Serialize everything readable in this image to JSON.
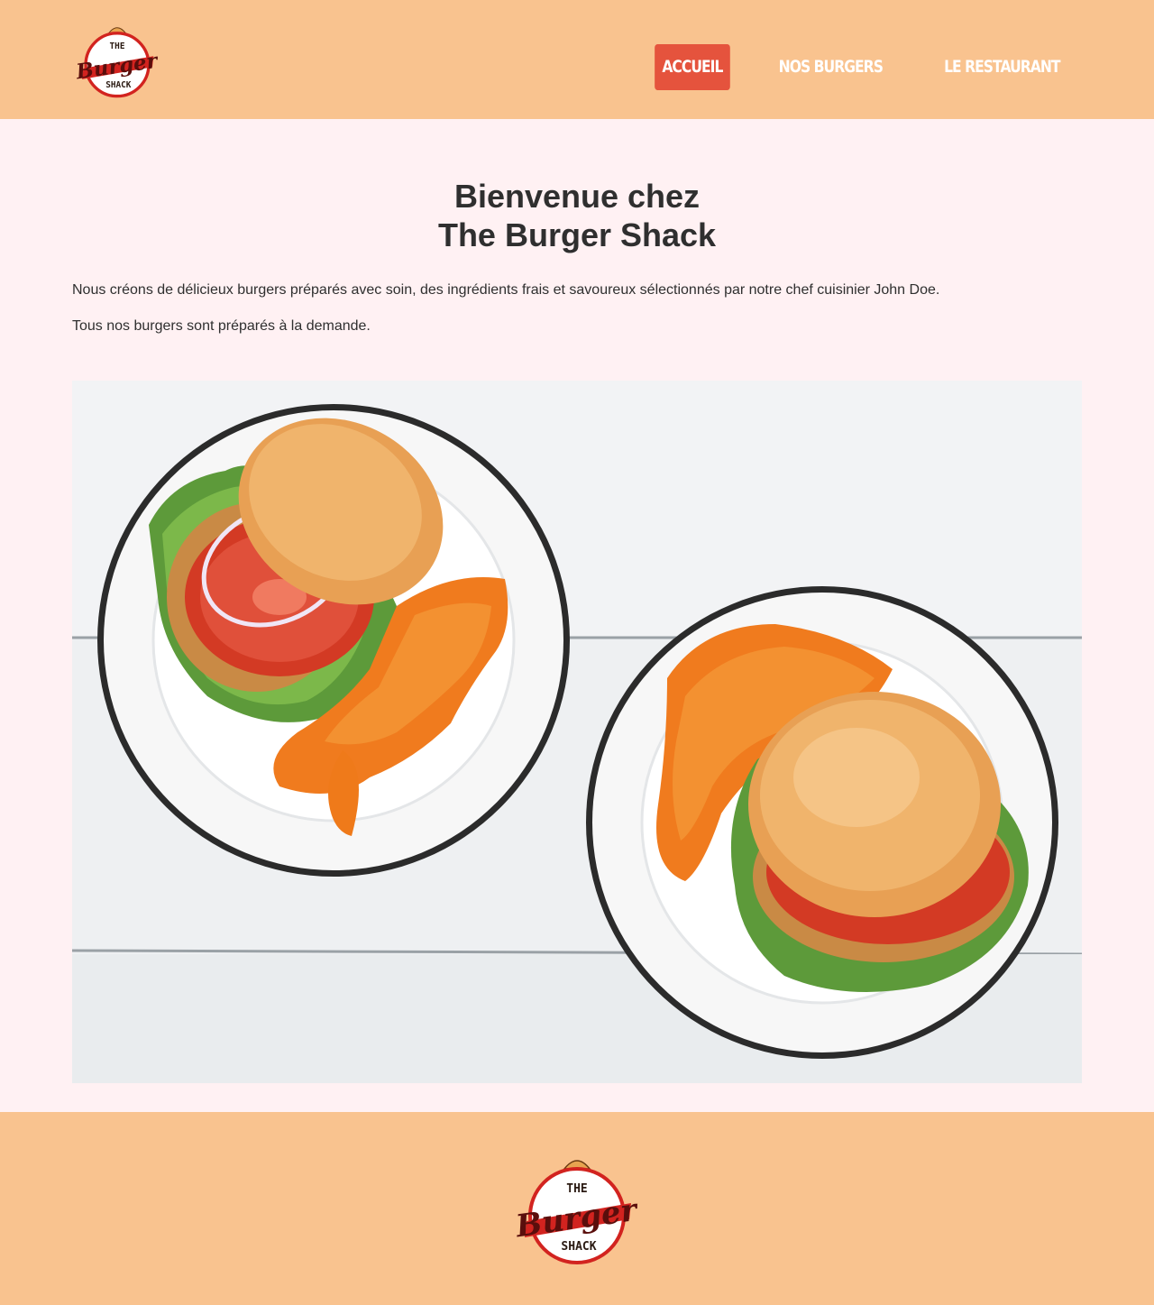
{
  "header": {
    "logo": {
      "top_text": "THE",
      "middle_text": "Burger",
      "bottom_text": "SHACK"
    },
    "nav": [
      {
        "label": "ACCUEIL",
        "active": true
      },
      {
        "label": "NOS BURGERS",
        "active": false
      },
      {
        "label": "LE RESTAURANT",
        "active": false
      }
    ]
  },
  "main": {
    "title_line1": "Bienvenue chez",
    "title_line2": "The Burger Shack",
    "paragraph1": "Nous créons de délicieux burgers préparés avec soin, des ingrédients frais et savoureux sélectionnés par notre chef cuisinier John Doe.",
    "paragraph2": "Tous nos burgers sont préparés à la demande."
  },
  "footer": {
    "logo": {
      "top_text": "THE",
      "middle_text": "Burger",
      "bottom_text": "SHACK"
    }
  },
  "colors": {
    "header_bg": "#f9c38f",
    "page_bg": "#fff1f3",
    "active_nav": "#e5533d",
    "logo_red": "#d2231f",
    "text": "#2f2f2f"
  }
}
